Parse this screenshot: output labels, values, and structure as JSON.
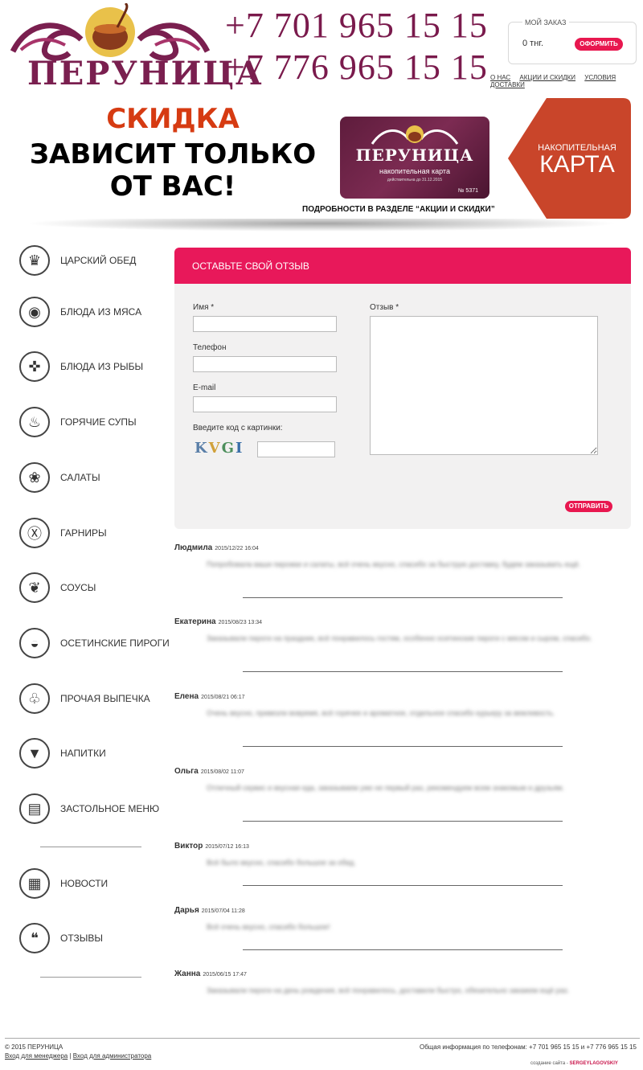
{
  "header": {
    "logo_text": "ПЕРУНИЦА",
    "phones": [
      "+7 701 965 15 15",
      "+7 776 965 15 15"
    ],
    "order": {
      "title": "МОЙ ЗАКАЗ",
      "sum": "0 тнг.",
      "checkout_label": "ОФОРМИТЬ"
    },
    "nav": [
      "О НАС",
      "АКЦИИ И СКИДКИ",
      "УСЛОВИЯ ДОСТАВКИ"
    ]
  },
  "banner": {
    "line1": "СКИДКА",
    "line2": "ЗАВИСИТ ТОЛЬКО",
    "line3": "ОТ ВАС!",
    "card_title": "ПЕРУНИЦА",
    "card_subtitle": "накопительная карта",
    "card_valid": "действительна до 31.12.2015",
    "card_number": "№ 5371",
    "karta_small": "НАКОПИТЕЛЬНАЯ",
    "karta_big": "КАРТА",
    "caption": "ПОДРОБНОСТИ В РАЗДЕЛЕ “АКЦИИ И СКИДКИ”"
  },
  "sidebar": {
    "items": [
      {
        "label": "ЦАРСКИЙ ОБЕД",
        "icon": "crown-icon",
        "glyph": "♛"
      },
      {
        "label": "БЛЮДА ИЗ МЯСА",
        "icon": "meat-icon",
        "glyph": "◉"
      },
      {
        "label": "БЛЮДА ИЗ РЫБЫ",
        "icon": "fish-icon",
        "glyph": "✜"
      },
      {
        "label": "ГОРЯЧИЕ СУПЫ",
        "icon": "soup-icon",
        "glyph": "♨"
      },
      {
        "label": "САЛАТЫ",
        "icon": "salad-icon",
        "glyph": "❀"
      },
      {
        "label": "ГАРНИРЫ",
        "icon": "plate-icon",
        "glyph": "Ⓧ"
      },
      {
        "label": "СОУСЫ",
        "icon": "sauce-icon",
        "glyph": "❦"
      },
      {
        "label": "ОСЕТИНСКИЕ ПИРОГИ",
        "icon": "pie-icon",
        "glyph": "◒"
      },
      {
        "label": "ПРОЧАЯ ВЫПЕЧКА",
        "icon": "cupcake-icon",
        "glyph": "♧"
      },
      {
        "label": "НАПИТКИ",
        "icon": "cocktail-icon",
        "glyph": "▼"
      },
      {
        "label": "ЗАСТОЛЬНОЕ МЕНЮ",
        "icon": "menu-book-icon",
        "glyph": "▤"
      }
    ],
    "extra": [
      {
        "label": "НОВОСТИ",
        "icon": "newspaper-icon",
        "glyph": "▦"
      },
      {
        "label": "ОТЗЫВЫ",
        "icon": "speech-bubble-icon",
        "glyph": "❝"
      }
    ]
  },
  "form": {
    "heading": "ОСТАВЬТЕ СВОЙ ОТЗЫВ",
    "name_label": "Имя *",
    "name_value": "",
    "phone_label": "Телефон",
    "phone_value": "",
    "email_label": "E-mail",
    "email_value": "",
    "captcha_label": "Введите код с картинки:",
    "captcha_text": "KVGI",
    "captcha_value": "",
    "review_label": "Отзыв *",
    "review_value": "",
    "submit_label": "ОТПРАВИТЬ"
  },
  "reviews": [
    {
      "name": "Людмила",
      "date": "2015/12/22 16:04",
      "text": "Попробовала ваши пирожки и салаты, всё очень вкусно, спасибо за быструю доставку, будем заказывать ещё."
    },
    {
      "name": "Екатерина",
      "date": "2015/08/23 13:34",
      "text": "Заказывали пироги на праздник, всё понравилось гостям, особенно осетинские пироги с мясом и сыром, спасибо."
    },
    {
      "name": "Елена",
      "date": "2015/08/21 06:17",
      "text": "Очень вкусно, привезли вовремя, всё горячее и ароматное, отдельное спасибо курьеру за вежливость."
    },
    {
      "name": "Ольга",
      "date": "2015/08/02 11:07",
      "text": "Отличный сервис и вкусная еда, заказываем уже не первый раз, рекомендуем всем знакомым и друзьям."
    },
    {
      "name": "Виктор",
      "date": "2015/07/12 16:13",
      "text": "Всё было вкусно, спасибо большое за обед."
    },
    {
      "name": "Дарья",
      "date": "2015/07/04 11:28",
      "text": "Всё очень вкусно, спасибо большое!"
    },
    {
      "name": "Жанна",
      "date": "2015/06/15 17:47",
      "text": "Заказывали пироги на день рождения, всё понравилось, доставили быстро, обязательно закажем ещё раз."
    }
  ],
  "footer": {
    "copyright": "© 2015 ПЕРУНИЦА",
    "manager_link": "Вход для менеджера",
    "separator": "|",
    "admin_link": "Вход для администратора",
    "phones": "Общая информация по телефонам: +7 701 965 15 15 и +7 776 965 15 15",
    "credit_prefix": "создание сайта -",
    "credit_name": "SERGEYLAGOVSKIY"
  },
  "colors": {
    "brand": "#7a1a4c",
    "accent": "#e8185a",
    "promo": "#d63b12",
    "karta": "#c9452a"
  }
}
